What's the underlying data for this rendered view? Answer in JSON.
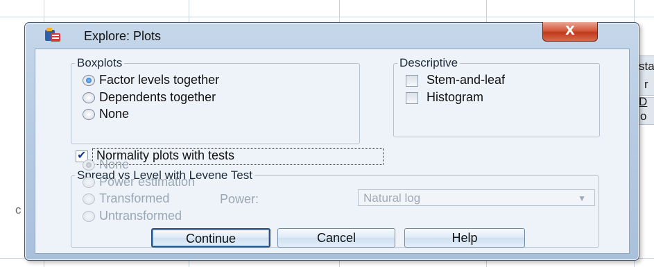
{
  "background": {
    "fragments": [
      "sta",
      "r",
      "D",
      "o",
      "c"
    ]
  },
  "window": {
    "title": "Explore: Plots",
    "close_label": "X"
  },
  "boxplots": {
    "legend": "Boxplots",
    "options": [
      {
        "label": "Factor levels together",
        "selected": true
      },
      {
        "label": "Dependents together",
        "selected": false
      },
      {
        "label": "None",
        "selected": false
      }
    ]
  },
  "descriptive": {
    "legend": "Descriptive",
    "options": [
      {
        "label": "Stem-and-leaf",
        "checked": false
      },
      {
        "label": "Histogram",
        "checked": false
      }
    ]
  },
  "normality": {
    "label": "Normality plots with tests",
    "checked": true
  },
  "spread": {
    "legend": "Spread vs Level with Levene Test",
    "options": [
      {
        "label": "None",
        "selected": true
      },
      {
        "label": "Power estimation",
        "selected": false
      },
      {
        "label": "Transformed",
        "selected": false
      },
      {
        "label": "Untransformed",
        "selected": false
      }
    ],
    "power_label": "Power:",
    "power_value": "Natural log",
    "enabled": false
  },
  "buttons": {
    "continue": "Continue",
    "cancel": "Cancel",
    "help": "Help"
  },
  "colors": {
    "title_gradient": "#b8cde4",
    "close_button": "#c8452a",
    "client": "#eef3fa"
  }
}
